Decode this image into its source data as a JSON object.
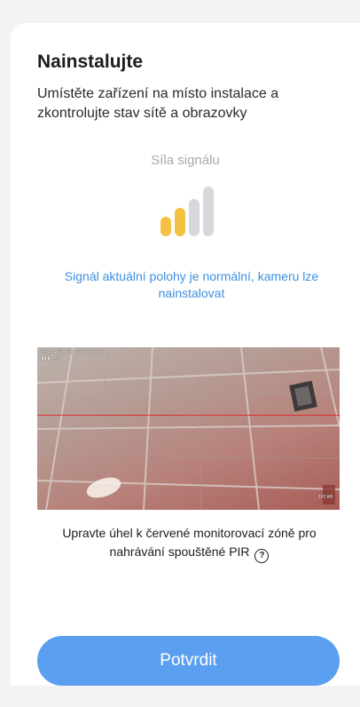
{
  "header": {
    "title": "Nainstalujte",
    "subtitle": "Umístěte zařízení na místo instalace a zkontrolujte stav sítě a obrazovky"
  },
  "signal": {
    "label": "Síla signálu",
    "level": 2,
    "max_level": 4,
    "active_color": "#f5c142",
    "inactive_color": "#d6d8dc",
    "status_text": "Signál aktuální polohy je normální, kameru lze nainstalovat",
    "status_color": "#3d8fe0"
  },
  "preview": {
    "timestamp": "2024-09/15 23:52:36",
    "signal_text": "4G",
    "brand": "IPCAM",
    "zone_line_color": "#e02020"
  },
  "pir_hint": {
    "text": "Upravte úhel k červené monitorovací zóně pro nahrávání spouštěné PIR",
    "icon": "help-circle-icon"
  },
  "footer": {
    "confirm_label": "Potvrdit",
    "button_color": "#5a9ff0"
  }
}
